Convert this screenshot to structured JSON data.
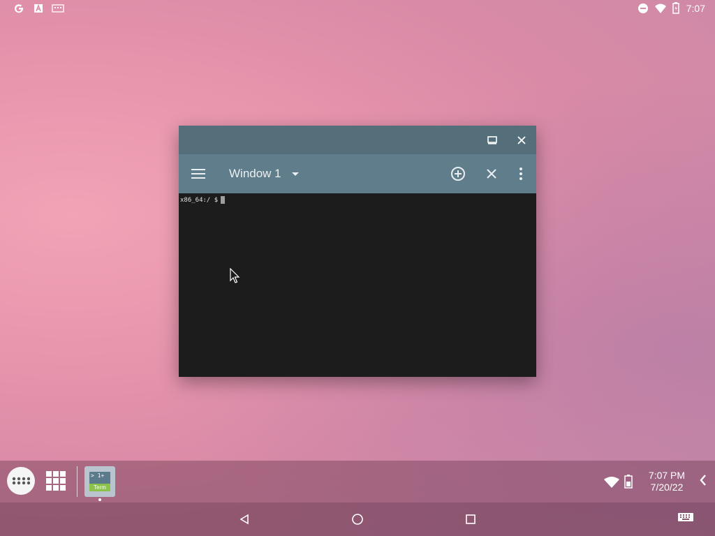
{
  "status_bar": {
    "time": "7:07",
    "left_icons": [
      "google-icon",
      "a-notification-icon",
      "keyboard-notification-icon"
    ],
    "right_icons": [
      "do-not-disturb-icon",
      "wifi-icon",
      "battery-icon"
    ]
  },
  "window": {
    "caption_buttons": [
      "maximize-icon",
      "close-icon"
    ],
    "toolbar": {
      "menu_icon": "hamburger-menu-icon",
      "window_select_label": "Window 1",
      "actions": [
        "add-window-icon",
        "close-window-icon",
        "more-options-icon"
      ]
    },
    "terminal": {
      "prompt": "x86_64:/ $"
    }
  },
  "taskbar": {
    "launcher": "app-launcher-icon",
    "app_grid": "all-apps-grid-icon",
    "pinned_app": {
      "name": "Term",
      "icon_text_top": "> 1+",
      "icon_text_bottom": "Term"
    },
    "tray": {
      "time": "7:07 PM",
      "date": "7/20/22"
    }
  },
  "navigation": [
    "back-icon",
    "home-icon",
    "recents-icon",
    "keyboard-icon"
  ],
  "colors": {
    "window_caption": "#546e7a",
    "window_toolbar": "#607d8b",
    "terminal_bg": "#1c1c1c",
    "term_icon_accent": "#8bc34a"
  }
}
